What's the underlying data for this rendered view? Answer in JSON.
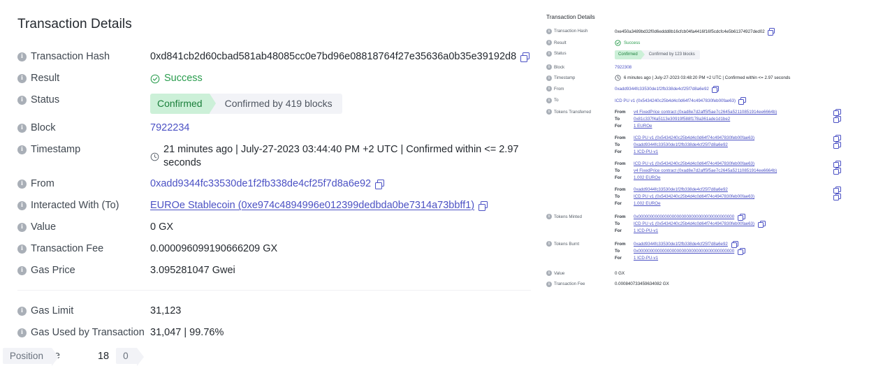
{
  "left": {
    "title": "Transaction Details",
    "rows": [
      {
        "label": "Transaction Hash",
        "value": "0xd841cb2d60cbad581ab48085cc0e7bd96e08818764f27e35636a0b35e39192d8"
      },
      {
        "label": "Result",
        "value": "Success"
      },
      {
        "label": "Status",
        "badge": "Confirmed",
        "blocks": "Confirmed by 419 blocks"
      },
      {
        "label": "Block",
        "value": "7922234"
      },
      {
        "label": "Timestamp",
        "value": "21 minutes ago | July-27-2023 03:44:40 PM +2 UTC | Confirmed within <= 2.97 seconds"
      },
      {
        "label": "From",
        "value": "0xadd9344fc33530de1f2fb338de4cf25f7d8a6e92"
      },
      {
        "label": "Interacted With (To)",
        "value": "EUROe Stablecoin (0xe974c4894996e012399dedbda0be7314a73bbff1)"
      },
      {
        "label": "Value",
        "value": "0 GX"
      },
      {
        "label": "Transaction Fee",
        "value": "0.000096099190666209 GX"
      },
      {
        "label": "Gas Price",
        "value": "3.095281047 Gwei"
      },
      {
        "label": "Gas Limit",
        "value": "31,123"
      },
      {
        "label": "Gas Used by Transaction",
        "value": "31,047 | 99.76%"
      },
      {
        "label": "Nonce",
        "position_label": "Position",
        "nonce_value": "18",
        "position_value": "0"
      }
    ]
  },
  "right": {
    "title": "Transaction Details",
    "rows": [
      {
        "label": "Transaction Hash",
        "value": "0xe450a3489bd32f0d6eddd8b16cfcb04fa4416f16f5cdcfc4e5b61374927ded02"
      },
      {
        "label": "Result",
        "value": "Success"
      },
      {
        "label": "Status",
        "badge": "Confirmed",
        "blocks": "Confirmed by 123 blocks"
      },
      {
        "label": "Block",
        "value": "7922308"
      },
      {
        "label": "Timestamp",
        "value": "6 minutes ago | July-27-2023 03:48:20 PM +2 UTC | Confirmed within <= 2.97 seconds"
      },
      {
        "label": "From",
        "value": "0xadd9344fc33530de1f2fb338de4cf25f7d8a6e92"
      },
      {
        "label": "To",
        "value": "ICD PU v1 (0x5434240c25b4d4c0d64f74c4947830feb00fae63)"
      }
    ],
    "tokens_transferred": {
      "label": "Tokens Transferred",
      "groups": [
        {
          "from_key": "From",
          "from_value": "v4 FixedPrice contract (0xad8e7d2aff5f5ae7c2645a52110851914ee6664b)",
          "from_underline": true,
          "to_key": "To",
          "to_value": "0x81c337f4a5113e30919f588f178a361ade1d1be2",
          "to_underline": false,
          "for_key": "For",
          "for_value": "1 EUROe"
        },
        {
          "from_key": "From",
          "from_value": "ICD PU v1 (0x5434240c25b4d4c0d64f74c4947830feb00fae63)",
          "from_underline": false,
          "to_key": "To",
          "to_value": "0xadd9344fc33530de1f2fb338de4cf25f7d8a6e92",
          "to_underline": false,
          "for_key": "For",
          "for_value": "1 ICD-PU-v1"
        },
        {
          "from_key": "From",
          "from_value": "ICD PU v1 (0x5434240c25b4d4c0d64f74c4947830feb00fae63)",
          "from_underline": false,
          "to_key": "To",
          "to_value": "v4 FixedPrice contract (0xad8e7d2aff5f5ae7c2645a52110851914ee6664b)",
          "to_underline": true,
          "for_key": "For",
          "for_value": "1.002 EUROe"
        },
        {
          "from_key": "From",
          "from_value": "0xadd9344fc33530de1f2fb338de4cf25f7d8a6e92",
          "from_underline": false,
          "to_key": "To",
          "to_value": "ICD PU v1 (0x5434240c25b4d4c0d64f74c4947830feb00fae63)",
          "to_underline": false,
          "for_key": "For",
          "for_value": "1.002 EUROe"
        }
      ]
    },
    "tokens_minted": {
      "label": "Tokens Minted",
      "from_key": "From",
      "from_value": "0x0000000000000000000000000000000000000000",
      "to_key": "To",
      "to_value": "ICD PU v1 (0x5434240c25b4d4c0d64f74c4947830feb00fae63)",
      "for_key": "For",
      "for_value": "1 ICD-PU-v1"
    },
    "tokens_burnt": {
      "label": "Tokens Burnt",
      "from_key": "From",
      "from_value": "0xadd9344fc33530de1f2fb338de4cf25f7d8a6e92",
      "to_key": "To",
      "to_value": "0x0000000000000000000000000000000000000000",
      "for_key": "For",
      "for_value": "1 ICD-PU-v1"
    },
    "footer_rows": [
      {
        "label": "Value",
        "value": "0 GX"
      },
      {
        "label": "Transaction Fee",
        "value": "0.000840733459634082 GX"
      }
    ]
  },
  "icons": {
    "info": "i",
    "copy": "copy-icon",
    "check": "check-circle-icon",
    "clock": "clock-icon"
  },
  "colors": {
    "link": "#4b51c4",
    "success": "#2a9d4e",
    "badge_bg": "#ccf0d8",
    "badge_text": "#1b7f3b",
    "neutral_bg": "#f2f3f7",
    "text": "#24292f",
    "label": "#3f4750"
  }
}
